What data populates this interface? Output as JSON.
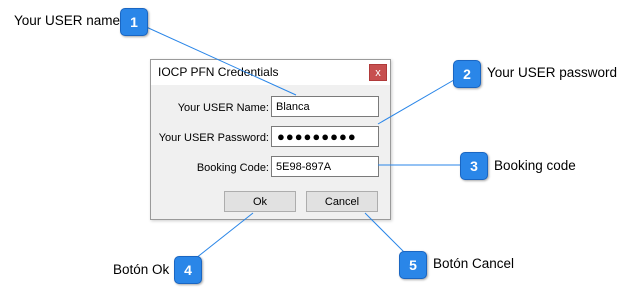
{
  "dialog": {
    "title": "IOCP PFN Credentials",
    "close_glyph": "x",
    "fields": {
      "user_name": {
        "label": "Your USER Name:",
        "value": "Blanca"
      },
      "user_password": {
        "label": "Your USER Password:",
        "masked": "●●●●●●●●●"
      },
      "booking_code": {
        "label": "Booking Code:",
        "value": "5E98-897A"
      }
    },
    "buttons": {
      "ok": "Ok",
      "cancel": "Cancel"
    }
  },
  "callouts": [
    {
      "number": "1",
      "text": "Your USER name"
    },
    {
      "number": "2",
      "text": "Your USER password"
    },
    {
      "number": "3",
      "text": "Booking code"
    },
    {
      "number": "4",
      "text": "Botón Ok"
    },
    {
      "number": "5",
      "text": "Botón Cancel"
    }
  ],
  "colors": {
    "badge": "#2a86e8",
    "leader": "#2a86e8",
    "close": "#c75050"
  },
  "icons": {
    "close": "close-icon"
  }
}
